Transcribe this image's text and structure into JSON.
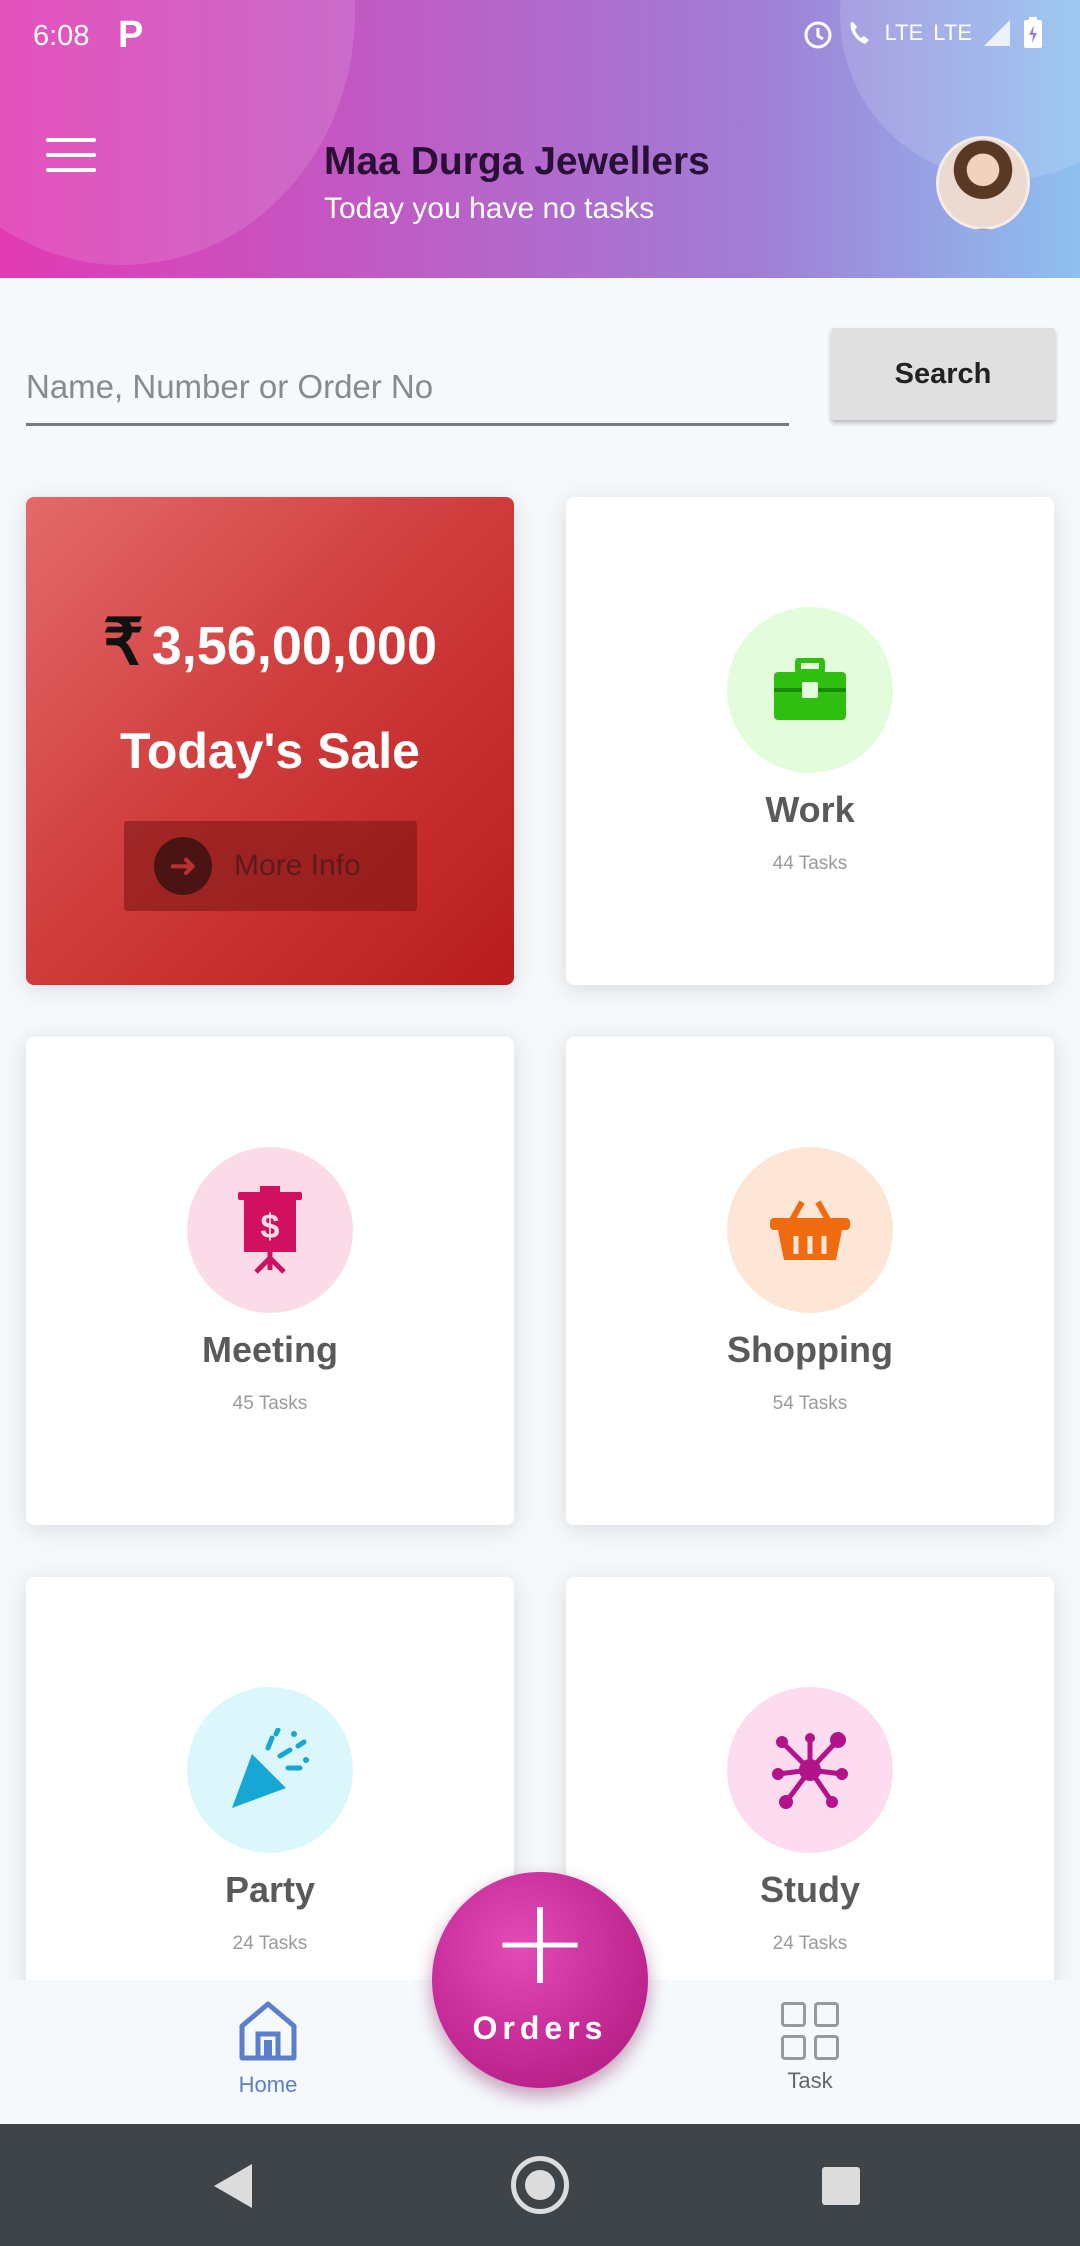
{
  "status_bar": {
    "time": "6:08",
    "app_badge": "P",
    "network_1": "LTE",
    "network_2": "LTE"
  },
  "header": {
    "title": "Maa Durga Jewellers",
    "subtitle": "Today you have no tasks",
    "gradient_start": "#e23ab3",
    "gradient_end": "#8ec0ef"
  },
  "search": {
    "placeholder": "Name, Number or Order No",
    "value": "",
    "button_label": "Search"
  },
  "sale_card": {
    "currency_symbol": "₹",
    "amount": "3,56,00,000",
    "label": "Today's Sale",
    "button_label": "More Info",
    "color": "#cf3a3a"
  },
  "categories": [
    {
      "title": "Work",
      "tasks": "44 Tasks",
      "icon": "briefcase-icon",
      "icon_color": "#2fbf10",
      "bg": "#e3fcdc"
    },
    {
      "title": "Meeting",
      "tasks": "45 Tasks",
      "icon": "presentation-icon",
      "icon_color": "#d1105f",
      "bg": "#fcdbe9"
    },
    {
      "title": "Shopping",
      "tasks": "54 Tasks",
      "icon": "basket-icon",
      "icon_color": "#f06a10",
      "bg": "#fde6d6"
    },
    {
      "title": "Party",
      "tasks": "24 Tasks",
      "icon": "party-popper-icon",
      "icon_color": "#18a7d4",
      "bg": "#dcf7fb"
    },
    {
      "title": "Study",
      "tasks": "24 Tasks",
      "icon": "molecule-icon",
      "icon_color": "#b3128a",
      "bg": "#fcdcee"
    }
  ],
  "bottom_nav": {
    "home_label": "Home",
    "task_label": "Task",
    "fab_label": "Orders",
    "accent": "#5b7fcc",
    "fab_color": "#c52b96"
  }
}
